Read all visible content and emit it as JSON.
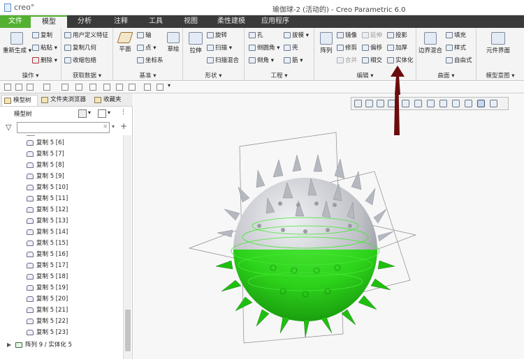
{
  "window": {
    "logo_text": "creo°",
    "title": "瑜伽球-2 (活动的) - Creo Parametric 6.0"
  },
  "tabs": [
    {
      "label": "文件"
    },
    {
      "label": "模型"
    },
    {
      "label": "分析"
    },
    {
      "label": "注释"
    },
    {
      "label": "工具"
    },
    {
      "label": "视图"
    },
    {
      "label": "柔性建模"
    },
    {
      "label": "应用程序"
    }
  ],
  "ribbon": {
    "operations": {
      "label": "操作 ▾",
      "regen": "重新生成 ▾",
      "copy": "复制",
      "paste": "粘贴 ▾",
      "delete": "删除 ▾"
    },
    "get_data": {
      "label": "获取数据 ▾",
      "udf": "用户定义特征",
      "copy_geom": "复制几何",
      "shrinkwrap": "收缩包络"
    },
    "datum": {
      "label": "基准 ▾",
      "plane": "平面",
      "axis": "轴",
      "point": "点 ▾",
      "csys": "坐标系",
      "sketch": "草绘"
    },
    "shapes": {
      "label": "形状 ▾",
      "extrude": "拉伸",
      "revolve": "旋转",
      "sweep": "扫描 ▾",
      "swept_blend": "扫描混合"
    },
    "engineering": {
      "label": "工程 ▾",
      "hole": "孔",
      "round": "倒圆角 ▾",
      "chamfer": "倒角 ▾",
      "draft": "拔模 ▾",
      "shell": "壳",
      "rib": "筋 ▾"
    },
    "editing": {
      "label": "编辑 ▾",
      "pattern": "阵列",
      "mirror": "镜像",
      "trim": "修剪",
      "merge": "合并",
      "extend": "延伸",
      "offset": "偏移",
      "intersect": "相交",
      "project": "投影",
      "thicken": "加厚",
      "solidify": "实体化"
    },
    "surfaces": {
      "label": "曲面 ▾",
      "boundary_blend": "边界混合",
      "fill": "填充",
      "style": "样式",
      "freestyle": "自由式"
    },
    "model_intent": {
      "label": "模型意图 ▾",
      "component_interface": "元件界面"
    }
  },
  "panel": {
    "tabs": [
      {
        "label": "模型树"
      },
      {
        "label": "文件夹浏览器"
      },
      {
        "label": "收藏夹"
      }
    ],
    "tree_title": "模型树",
    "filter": {
      "value": "",
      "placeholder": ""
    },
    "tree_items": [
      {
        "label": "复制 5 [6]"
      },
      {
        "label": "复制 5 [7]"
      },
      {
        "label": "复制 5 [8]"
      },
      {
        "label": "复制 5 [9]"
      },
      {
        "label": "复制 5 [10]"
      },
      {
        "label": "复制 5 [11]"
      },
      {
        "label": "复制 5 [12]"
      },
      {
        "label": "复制 5 [13]"
      },
      {
        "label": "复制 5 [14]"
      },
      {
        "label": "复制 5 [15]"
      },
      {
        "label": "复制 5 [16]"
      },
      {
        "label": "复制 5 [17]"
      },
      {
        "label": "复制 5 [18]"
      },
      {
        "label": "复制 5 [19]"
      },
      {
        "label": "复制 5 [20]"
      },
      {
        "label": "复制 5 [21]"
      },
      {
        "label": "复制 5 [22]"
      },
      {
        "label": "复制 5 [23]"
      }
    ],
    "pattern_item": {
      "label": "阵列 9 / 实体化 5"
    }
  },
  "colors": {
    "accent_green": "#54b030",
    "selection_green": "#2dd41b",
    "ball_gray": "#bfc1c7",
    "arrow_red": "#6b0c0c"
  }
}
